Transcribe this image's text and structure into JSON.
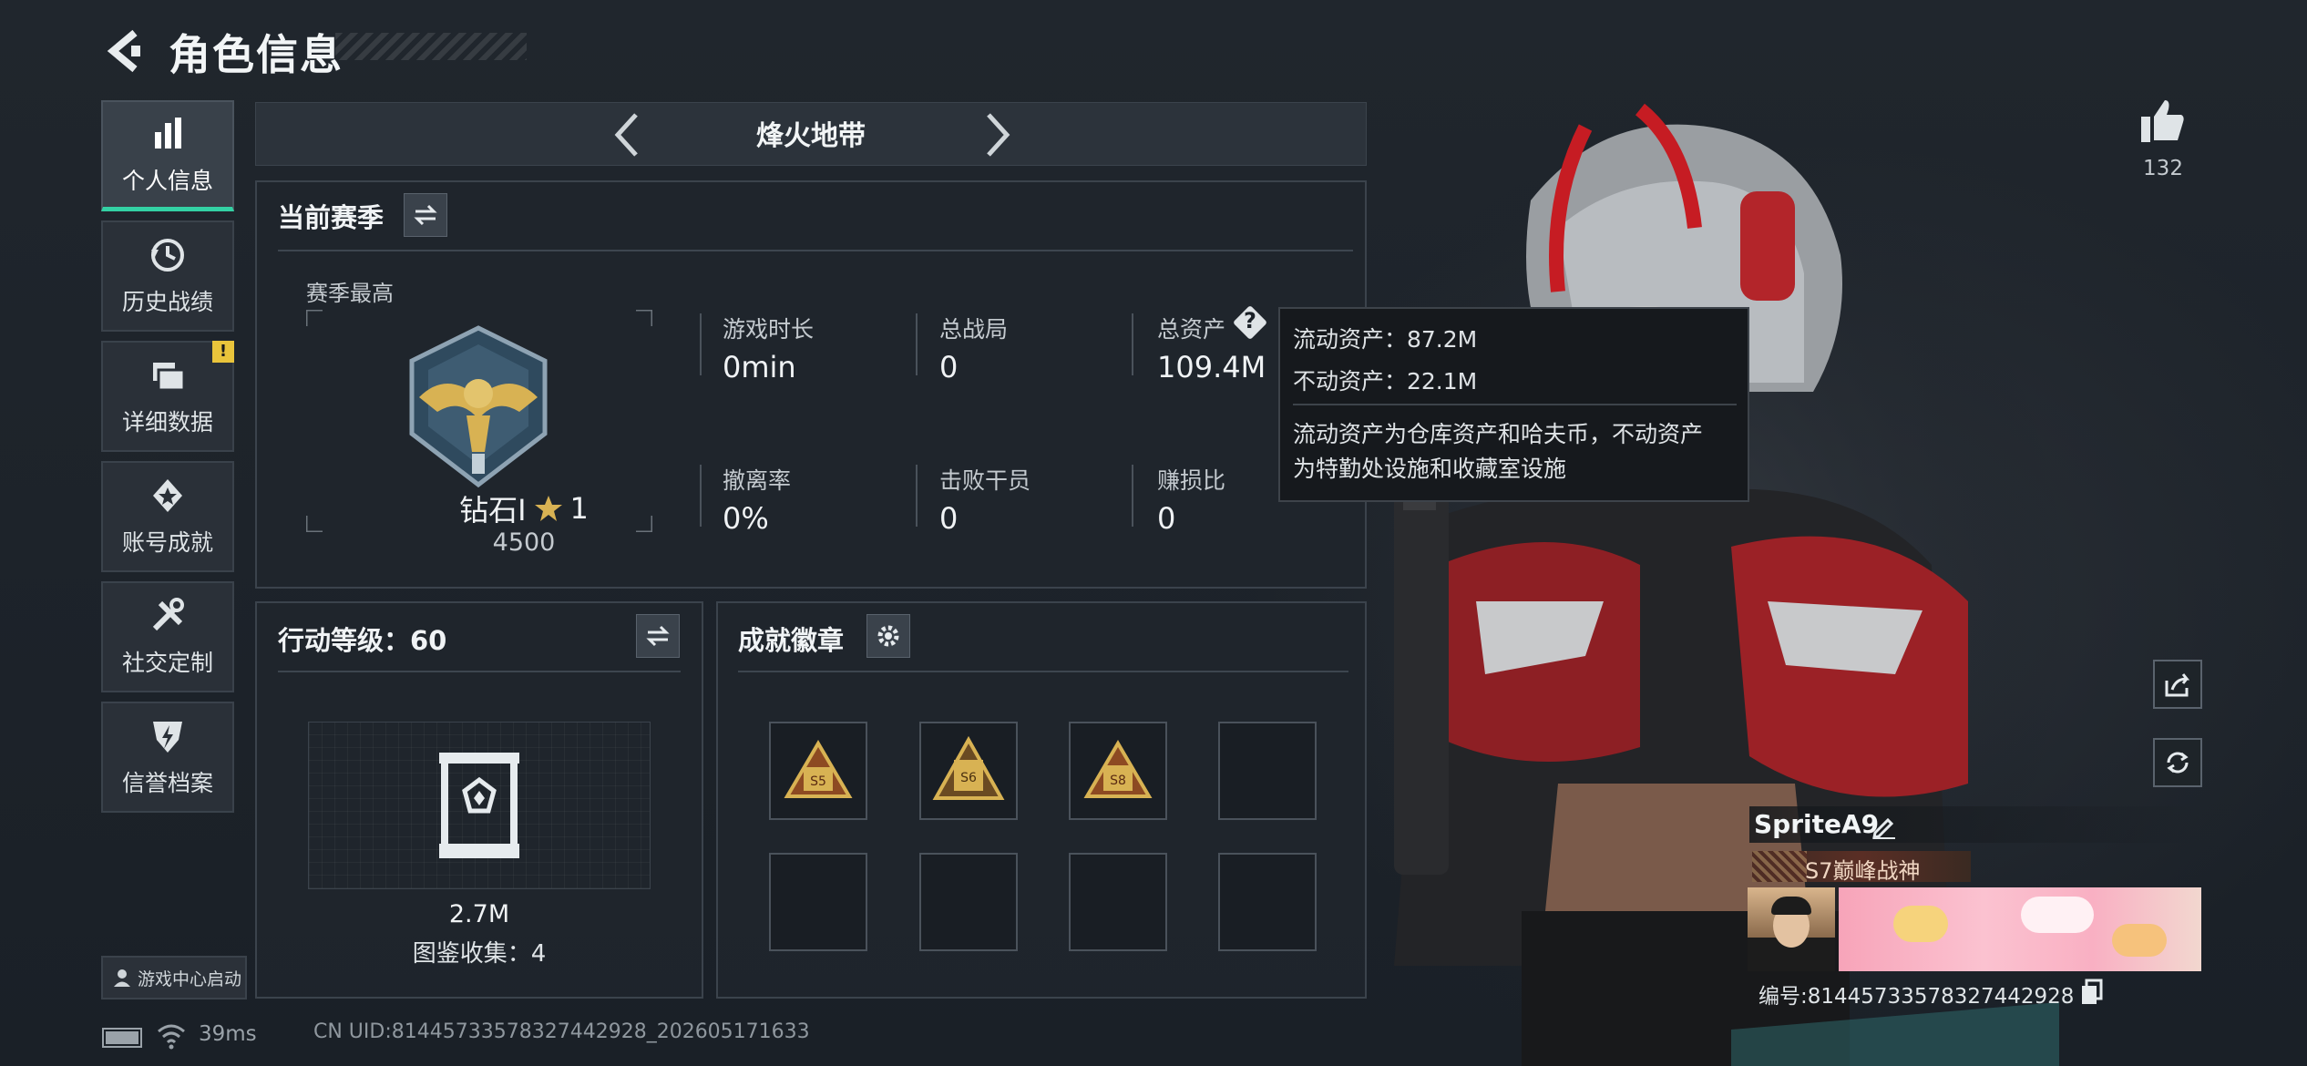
{
  "header": {
    "title": "角色信息"
  },
  "nav": {
    "items": [
      {
        "label": "个人信息",
        "icon": "bar-chart-icon",
        "active": true
      },
      {
        "label": "历史战绩",
        "icon": "history-clock-icon"
      },
      {
        "label": "详细数据",
        "icon": "folder-icon",
        "badge": "!"
      },
      {
        "label": "账号成就",
        "icon": "achievement-star-icon"
      },
      {
        "label": "社交定制",
        "icon": "tools-icon"
      },
      {
        "label": "信誉档案",
        "icon": "credit-shield-icon"
      }
    ],
    "launch_label": "游戏中心启动"
  },
  "mode": {
    "title": "烽火地带"
  },
  "season": {
    "title": "当前赛季",
    "best_label": "赛季最高",
    "rank_name": "钻石Ⅰ",
    "rank_stars": "1",
    "rank_score": "4500",
    "stats": [
      {
        "label": "游戏时长",
        "value": "0min"
      },
      {
        "label": "总战局",
        "value": "0"
      },
      {
        "label": "总资产",
        "value": "109.4M"
      },
      {
        "label": "撤离率",
        "value": "0%"
      },
      {
        "label": "击败干员",
        "value": "0"
      },
      {
        "label": "赚损比",
        "value": "0"
      }
    ]
  },
  "tooltip": {
    "liquid": "流动资产：87.2M",
    "fixed": "不动资产：22.1M",
    "desc1": "流动资产为仓库资产和哈夫币，不动资产",
    "desc2": "为特勤处设施和收藏室设施"
  },
  "level": {
    "title": "行动等级：60",
    "value": "2.7M",
    "collection": "图鉴收集：4"
  },
  "badges": {
    "title": "成就徽章",
    "items": [
      "S5",
      "S6",
      "S8"
    ]
  },
  "likes": {
    "count": "132"
  },
  "player": {
    "name": "SpriteA9",
    "title": "S7巅峰战神",
    "id_text": "编号:81445733578327442928"
  },
  "status": {
    "ping": "39ms",
    "uid": "CN UID:81445733578327442928_202605171633"
  },
  "colors": {
    "accent": "#33d1a4",
    "gold": "#d8b253",
    "badge_warn": "#e9c43b"
  }
}
